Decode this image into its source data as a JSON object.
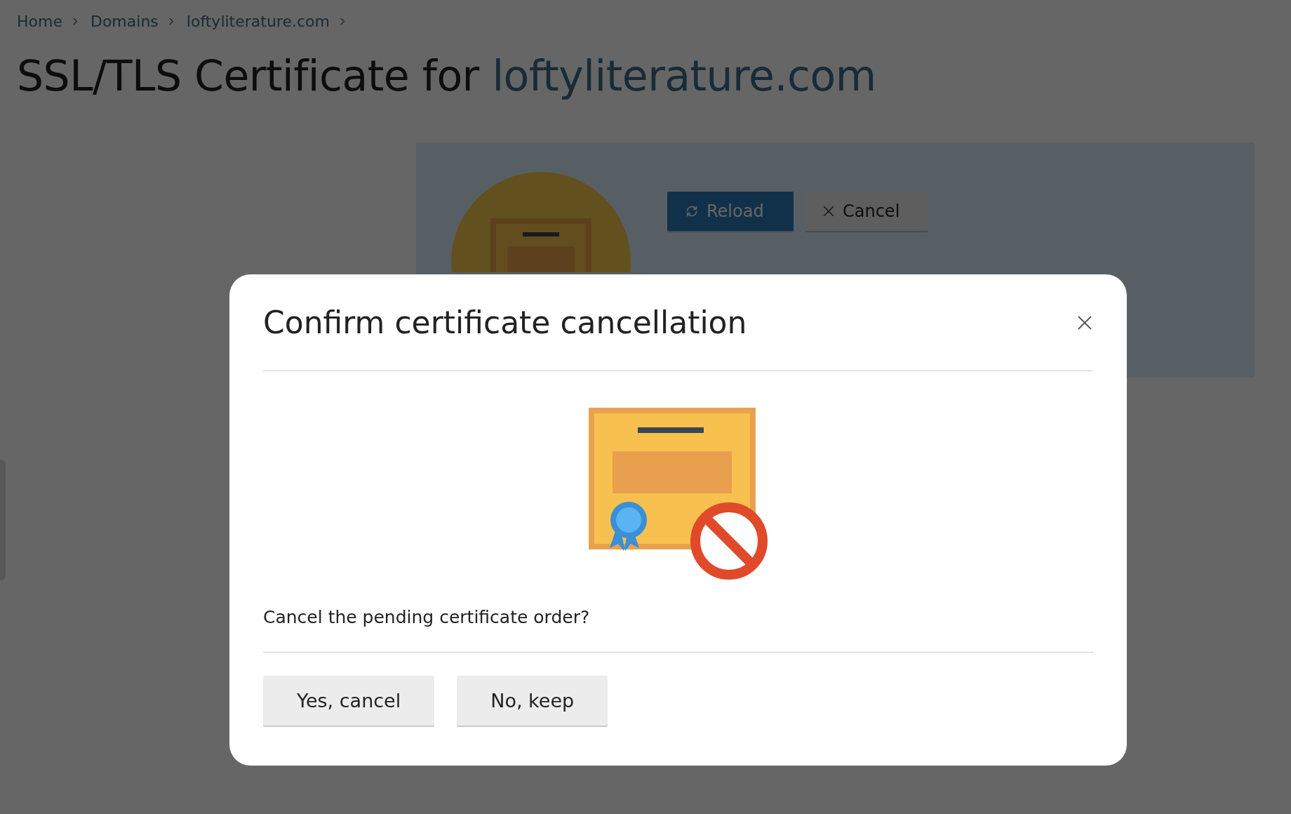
{
  "breadcrumb": [
    "Home",
    "Domains",
    "loftyliterature.com"
  ],
  "page_title": {
    "text": "SSL/TLS Certificate for",
    "domain": "loftyliterature.com"
  },
  "toolbar": [
    {
      "label": "Reload",
      "kind": "primary"
    },
    {
      "label": "Cancel",
      "kind": "secondary"
    }
  ],
  "dialog": {
    "title": "Confirm certificate cancellation",
    "message": "Cancel the pending certificate order?",
    "buttons": [
      "Yes, cancel",
      "No, keep"
    ]
  }
}
